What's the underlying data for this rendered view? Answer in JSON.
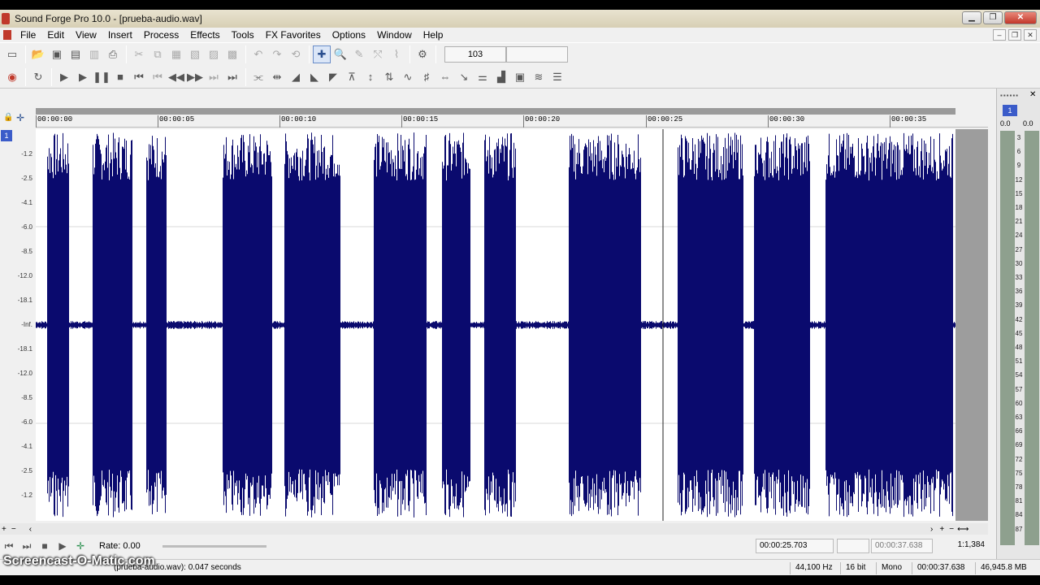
{
  "window": {
    "title": "Sound Forge Pro 10.0 - [prueba-audio.wav]"
  },
  "menu": [
    "File",
    "Edit",
    "View",
    "Insert",
    "Process",
    "Effects",
    "Tools",
    "FX Favorites",
    "Options",
    "Window",
    "Help"
  ],
  "toolbar": {
    "zoom_value": "103"
  },
  "ruler": {
    "ticks": [
      "00:00:00",
      "00:00:05",
      "00:00:10",
      "00:00:15",
      "00:00:20",
      "00:00:25",
      "00:00:30",
      "00:00:35"
    ]
  },
  "db_scale": [
    "-1.2",
    "-2.5",
    "-4.1",
    "-6.0",
    "-8.5",
    "-12.0",
    "-18.1",
    "-Inf.",
    "-18.1",
    "-12.0",
    "-8.5",
    "-6.0",
    "-4.1",
    "-2.5",
    "-1.2"
  ],
  "channel": {
    "number": "1"
  },
  "transport": {
    "rate_label": "Rate: 0.00"
  },
  "time_boxes": {
    "cursor": "00:00:25.703",
    "length": "00:00:37.638",
    "zoom_ratio": "1:1,384"
  },
  "status": {
    "message": "(prueba-audio.wav): 0.047 seconds",
    "sample_rate": "44,100 Hz",
    "bit_depth": "16 bit",
    "channels": "Mono",
    "duration": "00:00:37.638",
    "size": "46,945.8 MB"
  },
  "meters": {
    "channel": "1",
    "left_peak": "0.0",
    "right_peak": "0.0",
    "scale": [
      "3",
      "6",
      "9",
      "12",
      "15",
      "18",
      "21",
      "24",
      "27",
      "30",
      "33",
      "36",
      "39",
      "42",
      "45",
      "48",
      "51",
      "54",
      "57",
      "60",
      "63",
      "66",
      "69",
      "72",
      "75",
      "78",
      "81",
      "84",
      "87"
    ]
  },
  "watermark": "Screencast-O-Matic.com",
  "colors": {
    "waveform": "#0a0a6e",
    "accent": "#3b5cc9"
  }
}
